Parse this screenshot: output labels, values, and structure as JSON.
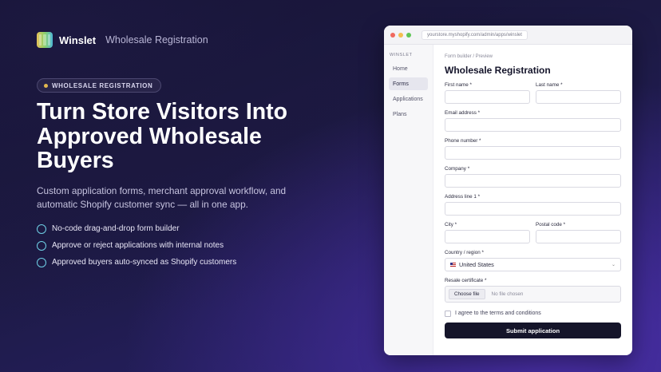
{
  "brand": {
    "name": "Winslet",
    "subtitle": "Wholesale Registration"
  },
  "badge": "WHOLESALE REGISTRATION",
  "headline": "Turn Store Visitors Into Approved Wholesale Buyers",
  "lead": "Custom application forms, merchant approval workflow, and automatic Shopify customer sync — all in one app.",
  "features": [
    "No-code drag-and-drop form builder",
    "Approve or reject applications with internal notes",
    "Approved buyers auto-synced as Shopify customers"
  ],
  "colors": {
    "accent": "#6fd0e6",
    "badge_dot": "#e2b84f",
    "submit": "#15152a"
  },
  "window": {
    "url": "yourstore.myshopify.com/admin/apps/winslet",
    "sidebar": {
      "heading": "WINSLET",
      "items": [
        "Home",
        "Forms",
        "Applications",
        "Plans"
      ],
      "active": "Forms"
    },
    "breadcrumb": "Form builder / Preview",
    "form": {
      "title": "Wholesale Registration",
      "first_name": "First name *",
      "last_name": "Last name *",
      "email": "Email address *",
      "phone": "Phone number *",
      "company": "Company *",
      "address": "Address line 1 *",
      "city": "City *",
      "postal": "Postal code *",
      "country_label": "Country / region *",
      "country_value": "United States",
      "resale_label": "Resale certificate *",
      "choose_file": "Choose file",
      "no_file": "No file chosen",
      "terms": "I agree to the terms and conditions",
      "submit": "Submit application"
    }
  }
}
